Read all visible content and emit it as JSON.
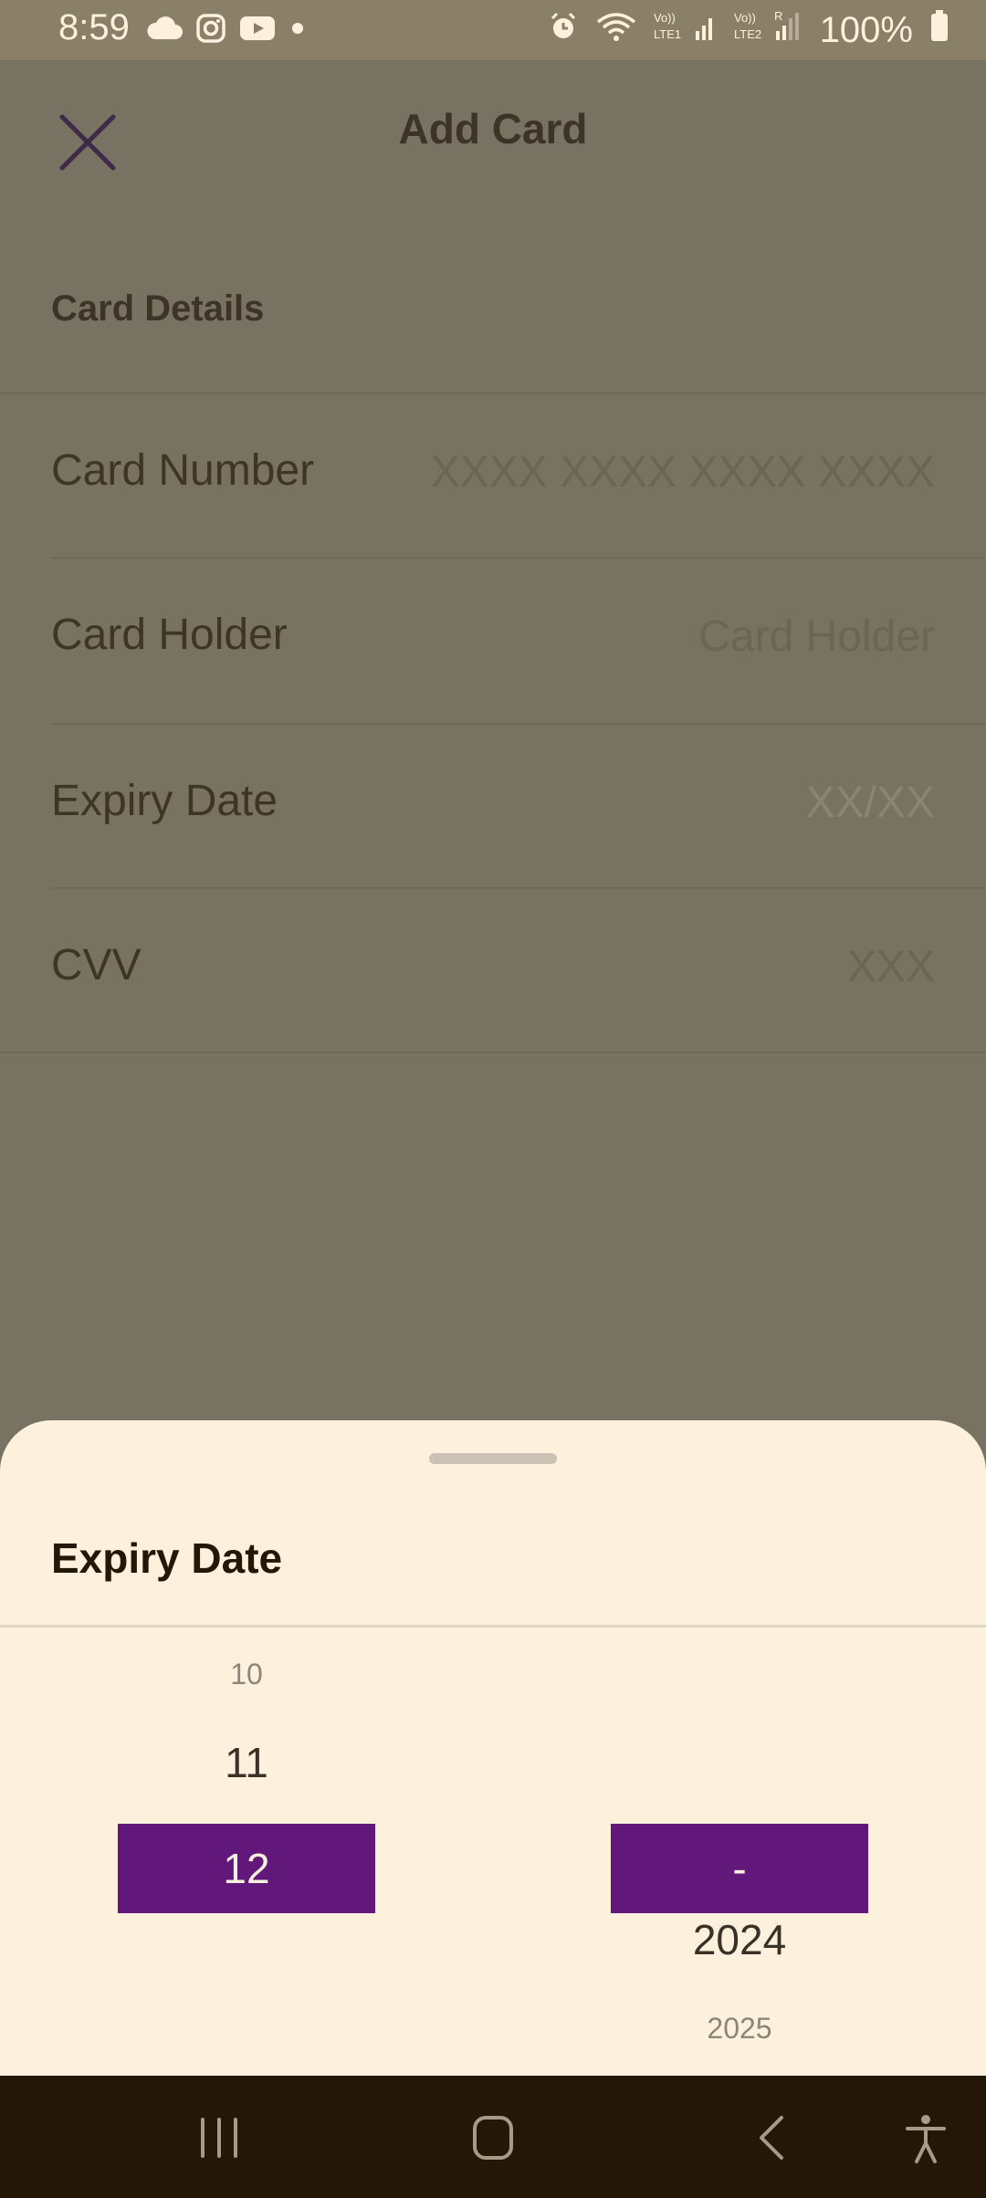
{
  "status_bar": {
    "time": "8:59",
    "battery": "100%",
    "left_icons": [
      "cloud-icon",
      "instagram-icon",
      "youtube-icon",
      "dot-icon"
    ],
    "right_icons": [
      "alarm-icon",
      "wifi-icon",
      "signal-lte1-icon",
      "signal-lte2-icon",
      "battery-icon"
    ]
  },
  "app_bar": {
    "title": "Add Card",
    "close_icon": "close-icon"
  },
  "form": {
    "section_title": "Card Details",
    "card_number": {
      "label": "Card Number",
      "placeholder": "XXXX XXXX XXXX XXXX"
    },
    "card_holder": {
      "label": "Card Holder",
      "placeholder": "Card Holder"
    },
    "expiry_date": {
      "label": "Expiry Date",
      "placeholder": "XX/XX"
    },
    "cvv": {
      "label": "CVV",
      "placeholder": "XXX"
    }
  },
  "bottom_sheet": {
    "title": "Expiry Date",
    "month_picker": {
      "items": [
        "10",
        "11",
        "12"
      ],
      "selected": "12"
    },
    "year_picker": {
      "items": [
        "-",
        "2024",
        "2025"
      ],
      "selected": "-"
    }
  },
  "nav_bar": {
    "buttons": [
      "recents-icon",
      "home-icon",
      "back-icon",
      "accessibility-icon"
    ]
  },
  "colors": {
    "accent": "#62177a",
    "sheet_background": "#fdf1dd",
    "scrim": "#777261",
    "nav_bar": "#241708"
  }
}
